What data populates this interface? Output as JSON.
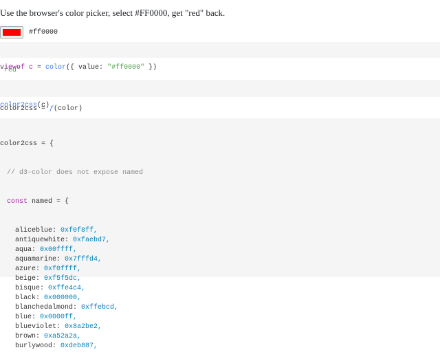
{
  "intro": "Use the browser's color picker, select #FF0000, get \"red\" back.",
  "picker": {
    "swatch_color": "#ff0000",
    "value": "#ff0000"
  },
  "cell1": {
    "p1": "viewof c",
    "p2": " = ",
    "p3": "color",
    "p4": "({ value: ",
    "p5": "\"#ff0000\"",
    "p6": " })"
  },
  "output1": "\"red\"",
  "cell2": {
    "p1": "color2css",
    "p2": "(c)"
  },
  "output2": {
    "p1": "color2css",
    "p2": " = ",
    "p3": "ƒ",
    "p4": "(color)"
  },
  "cell3": {
    "header": "color2css = {",
    "comment": "// d3-color does not expose named",
    "const_kw": "const",
    "const_rest": " named = {",
    "entries": [
      {
        "name": "aliceblue: ",
        "value": "0xf0f8ff,"
      },
      {
        "name": "antiquewhite: ",
        "value": "0xfaebd7,"
      },
      {
        "name": "aqua: ",
        "value": "0x00ffff,"
      },
      {
        "name": "aquamarine: ",
        "value": "0x7fffd4,"
      },
      {
        "name": "azure: ",
        "value": "0xf0ffff,"
      },
      {
        "name": "beige: ",
        "value": "0xf5f5dc,"
      },
      {
        "name": "bisque: ",
        "value": "0xffe4c4,"
      },
      {
        "name": "black: ",
        "value": "0x000000,"
      },
      {
        "name": "blanchedalmond: ",
        "value": "0xffebcd,"
      },
      {
        "name": "blue: ",
        "value": "0x0000ff,"
      },
      {
        "name": "blueviolet: ",
        "value": "0x8a2be2,"
      },
      {
        "name": "brown: ",
        "value": "0xa52a2a,"
      },
      {
        "name": "burlywood: ",
        "value": "0xdeb887,"
      }
    ]
  }
}
